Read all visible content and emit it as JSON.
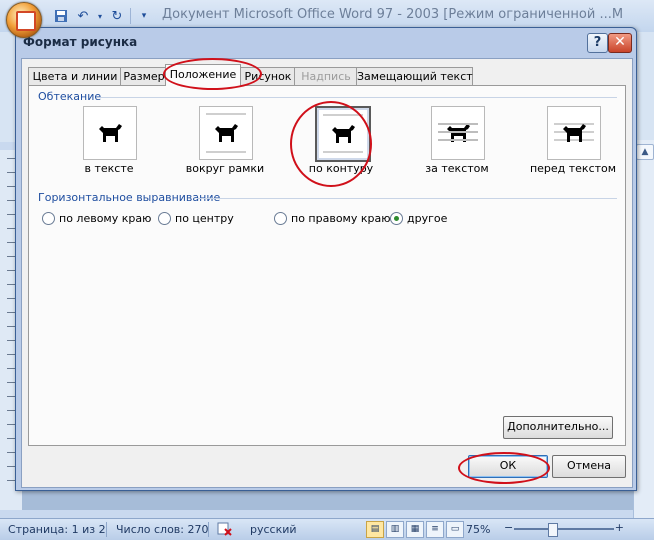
{
  "word": {
    "window_title": "Документ Microsoft Office Word 97 - 2003 [Режим ограниченной ...M",
    "qat_icons": [
      "save-icon",
      "undo-icon",
      "redo-icon",
      "customize-icon"
    ]
  },
  "dialog": {
    "title": "Формат рисунка",
    "help": "?",
    "close": "✕",
    "tabs": [
      {
        "label": "Цвета и линии",
        "state": "normal"
      },
      {
        "label": "Размер",
        "state": "normal"
      },
      {
        "label": "Положение",
        "state": "active"
      },
      {
        "label": "Рисунок",
        "state": "normal"
      },
      {
        "label": "Надпись",
        "state": "disabled"
      },
      {
        "label": "Замещающий текст",
        "state": "normal"
      }
    ],
    "wrapping": {
      "label": "Обтекание",
      "options": [
        {
          "label": "в тексте",
          "selected": false
        },
        {
          "label": "вокруг рамки",
          "selected": false
        },
        {
          "label": "по контуру",
          "selected": true
        },
        {
          "label": "за текстом",
          "selected": false
        },
        {
          "label": "перед текстом",
          "selected": false
        }
      ]
    },
    "horizontal_alignment": {
      "label": "Горизонтальное выравнивание",
      "options": [
        {
          "label": "по левому краю",
          "checked": false
        },
        {
          "label": "по центру",
          "checked": false
        },
        {
          "label": "по правому краю",
          "checked": false
        },
        {
          "label": "другое",
          "checked": true
        }
      ]
    },
    "advanced_button": "Дополнительно...",
    "ok_button": "ОК",
    "cancel_button": "Отмена"
  },
  "statusbar": {
    "page": "Страница: 1 из 2",
    "word_count": "Число слов: 270",
    "language": "русский",
    "zoom": "75%",
    "zoom_minus": "−",
    "zoom_plus": "+"
  },
  "colors": {
    "highlight": "#d0101a",
    "group_label": "#1f4ea0",
    "dialog_frame": "#b9cbe8"
  }
}
